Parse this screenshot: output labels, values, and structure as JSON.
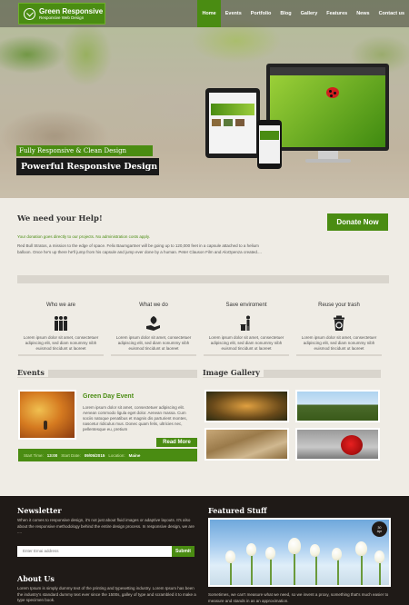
{
  "brand": {
    "title": "Green Responsive",
    "subtitle": "Responsive Web Design"
  },
  "nav": [
    "Home",
    "Events",
    "Portfolio",
    "Blog",
    "Gallery",
    "Features",
    "News",
    "Contact us"
  ],
  "hero": {
    "tagline": "Fully Responsive & Clean Design",
    "headline": "Powerful Responsive Design"
  },
  "help": {
    "title": "We need your Help!",
    "green_line": "Your donation goes directly to our projects. No administration costs apply.",
    "text": "Red Bull Stratos, a mission to the edge of space. Felix Baumgartner will be going up to 120,000 feet in a capsule attached to a helium balloon. Once he's up there he'll jump from his capsule and jump ever done by a human. Peter Clauson Film and AloOpenza created....",
    "donate_label": "Donate Now"
  },
  "features": [
    {
      "title": "Who we are",
      "icon": "people-icon",
      "text": "Lorem ipsum dolor sit amet, consectetuer adipiscing elit, sed diam nonummy nibh euismod tincidunt ut laoreet"
    },
    {
      "title": "What we do",
      "icon": "hand-leaf-icon",
      "text": "Lorem ipsum dolor sit amet, consectetuer adipiscing elit, sed diam nonummy nibh euismod tincidunt ut laoreet"
    },
    {
      "title": "Save enviroment",
      "icon": "trash-person-icon",
      "text": "Lorem ipsum dolor sit amet, consectetuer adipiscing elit, sed diam nonummy nibh euismod tincidunt ut laoreet"
    },
    {
      "title": "Reuse your trash",
      "icon": "recycle-bin-icon",
      "text": "Lorem ipsum dolor sit amet, consectetuer adipiscing elit, sed diam nonummy nibh euismod tincidunt ut laoreet"
    }
  ],
  "events": {
    "section_title": "Events",
    "event_title": "Green Day Event",
    "text": "Lorem ipsum dolor sit amet, consectetuer adipiscing elit. Aenean commodo ligula eget dolor. Aenean massa. Cum sociis natoque penatibus et magnis dis parturient montes, nascetur ridiculus mus. Donec quam felis, ultricies nec, pellentesque eu, pretium",
    "read_more": "Read More",
    "start_time_label": "Start Time:",
    "start_time": "13:00",
    "start_date_label": "Start Date:",
    "start_date": "09/05/2015",
    "location_label": "Location:",
    "location": "Maine"
  },
  "gallery": {
    "section_title": "Image Gallery"
  },
  "footer": {
    "newsletter_title": "Newsletter",
    "newsletter_text": "When it comes to responsive design, it's not just about fluid images or adaptive layouts. It's also about the responsive methodology behind the entire design process. In responsive design, we are ....",
    "email_placeholder": "Enter Emai address",
    "submit_label": "Submit",
    "about_title": "About Us",
    "about_text": "Lorem Ipsum is simply dummy text of the printing and typesetting industry. Lorem Ipsum has been the industry's standard dummy text ever since the 1500s, galley of type and scrambled it to make a type specimen book.",
    "featured_title": "Featured Stuff",
    "featured_date_day": "30",
    "featured_date_month": "Apr",
    "featured_text": "Sometimes, we can't measure what we need, so we invent a proxy, something that's much easier to measure and stands in as an approximation."
  },
  "colors": {
    "brand_green": "#4a8c12",
    "footer_bg": "#1f1a17",
    "page_bg": "#efece5"
  }
}
